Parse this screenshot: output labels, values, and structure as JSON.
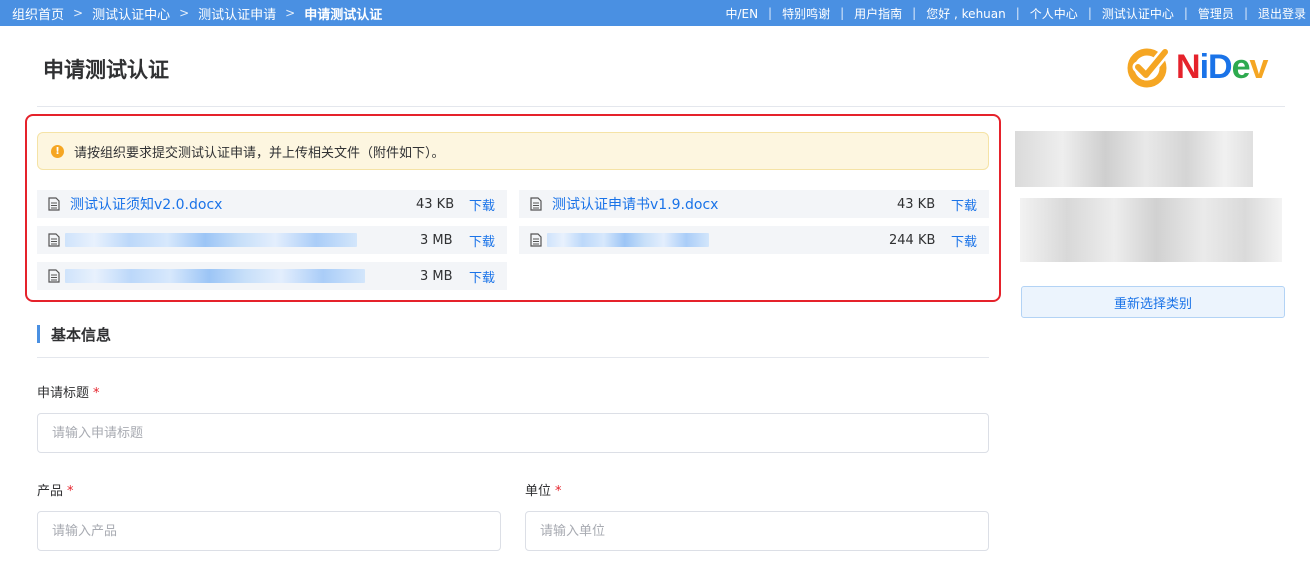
{
  "breadcrumb": [
    {
      "label": "组织首页"
    },
    {
      "label": "测试认证中心"
    },
    {
      "label": "测试认证申请"
    },
    {
      "label": "申请测试认证"
    }
  ],
  "breadcrumb_sep": ">",
  "top_links": [
    "中/EN",
    "特别鸣谢",
    "用户指南",
    "您好 , kehuan",
    "个人中心",
    "测试认证中心",
    "管理员",
    "退出登录"
  ],
  "top_link_sep": "|",
  "page_title": "申请测试认证",
  "logo": {
    "text": "NiDev",
    "colors": {
      "N": "#e5222b",
      "i": "#1a73e8",
      "D": "#1a73e8",
      "e": "#2eaa4f",
      "v": "#f5a623"
    }
  },
  "notice": {
    "icon": "exclamation-icon",
    "text": "请按组织要求提交测试认证申请，并上传相关文件（附件如下）。"
  },
  "attachments": [
    {
      "name": "测试认证须知v2.0.docx",
      "size": "43 KB",
      "download": "下载"
    },
    {
      "name": "测试认证申请书v1.9.docx",
      "size": "43 KB",
      "download": "下载"
    },
    {
      "name": "",
      "size": "3 MB",
      "download": "下载"
    },
    {
      "name": "",
      "size": "244 KB",
      "download": "下载"
    },
    {
      "name": "",
      "size": "3 MB",
      "download": "下载"
    }
  ],
  "reselect_button": "重新选择类别",
  "section_title": "基本信息",
  "form": {
    "title": {
      "label": "申请标题",
      "required_mark": "*",
      "placeholder": "请输入申请标题",
      "value": ""
    },
    "product": {
      "label": "产品",
      "required_mark": "*",
      "placeholder": "请输入产品",
      "value": ""
    },
    "unit": {
      "label": "单位",
      "required_mark": "*",
      "placeholder": "请输入单位",
      "value": ""
    }
  },
  "colors": {
    "topbar": "#4a90e2",
    "link": "#1a73e8",
    "highlight_border": "#e5222b",
    "notice_bg": "#fdf6e0"
  }
}
